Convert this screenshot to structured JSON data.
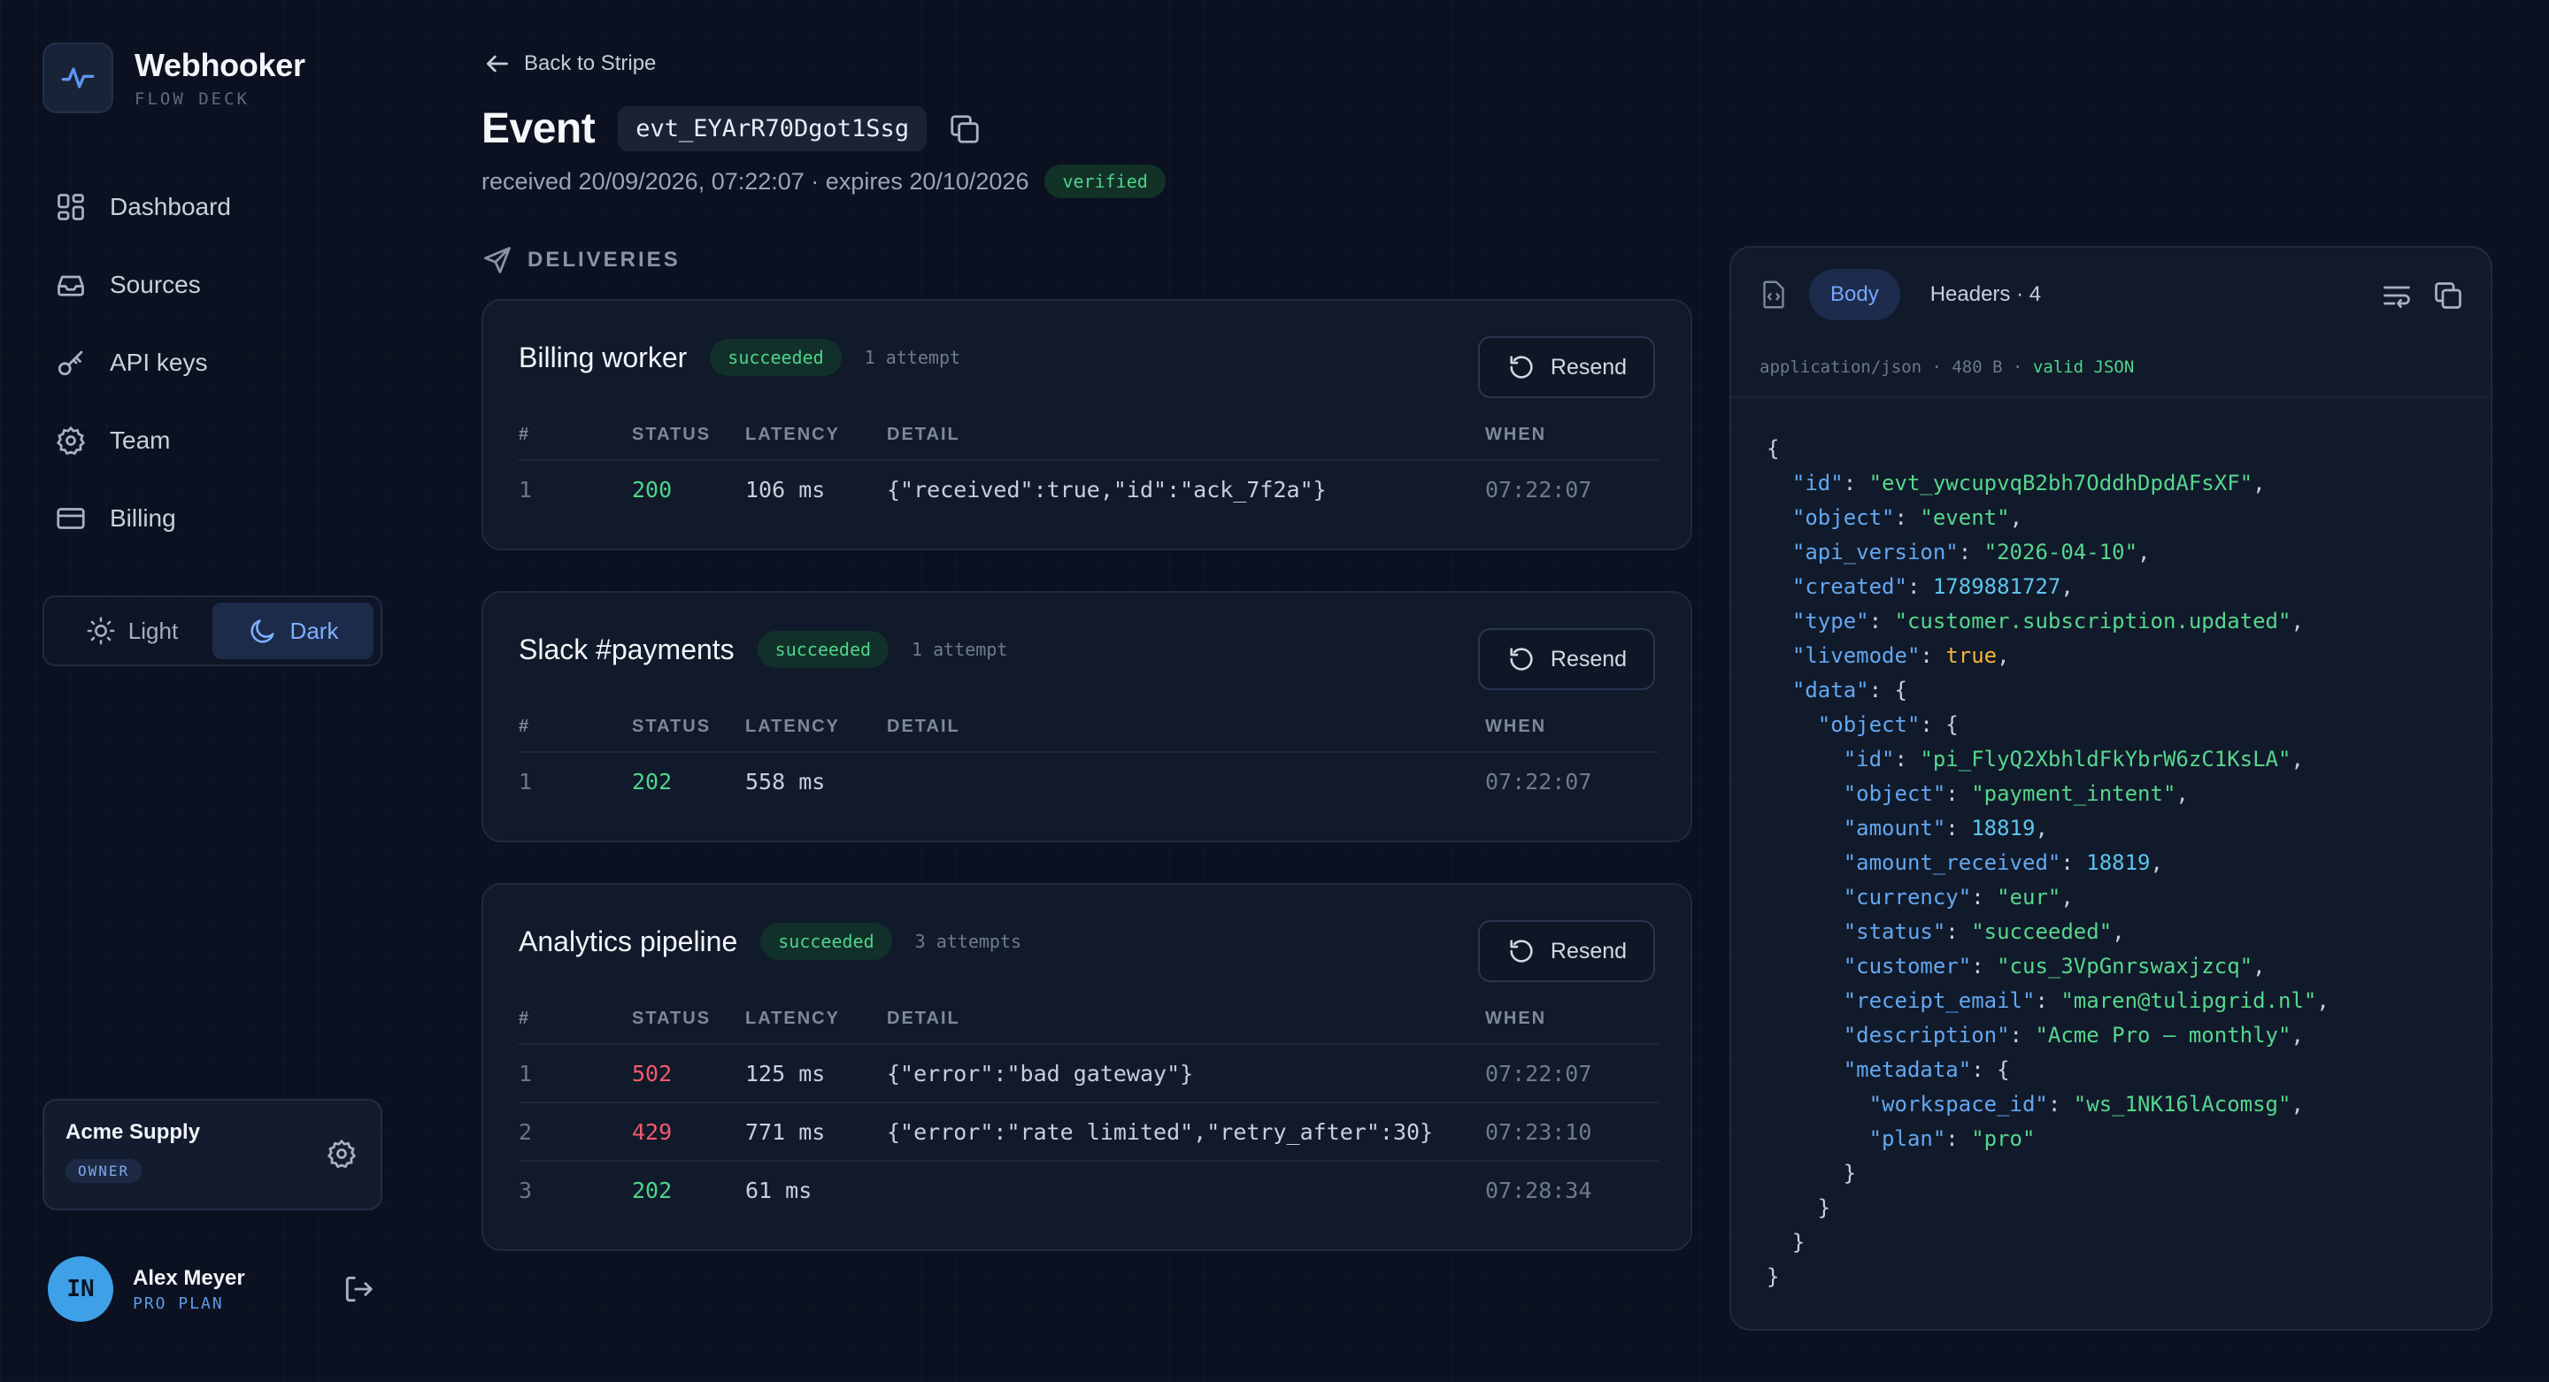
{
  "brand": {
    "name": "Webhooker",
    "sub": "FLOW DECK"
  },
  "nav": [
    {
      "label": "Dashboard",
      "icon": "dashboard-icon"
    },
    {
      "label": "Sources",
      "icon": "inbox-icon"
    },
    {
      "label": "API keys",
      "icon": "key-icon"
    },
    {
      "label": "Team",
      "icon": "gear-icon"
    },
    {
      "label": "Billing",
      "icon": "credit-card-icon"
    }
  ],
  "theme": {
    "light": "Light",
    "dark": "Dark",
    "selected": "Dark"
  },
  "org": {
    "name": "Acme Supply",
    "role": "OWNER"
  },
  "user": {
    "initials": "IN",
    "name": "Alex Meyer",
    "plan": "PRO PLAN"
  },
  "back_label": "Back to Stripe",
  "event": {
    "title": "Event",
    "id": "evt_EYArR70Dgot1Ssg",
    "meta": "received 20/09/2026, 07:22:07 · expires 20/10/2026",
    "badge": "verified"
  },
  "deliveries_heading": "DELIVERIES",
  "table_headers": {
    "num": "#",
    "status": "STATUS",
    "latency": "LATENCY",
    "detail": "DETAIL",
    "when": "WHEN"
  },
  "resend_label": "Resend",
  "deliveries": [
    {
      "name": "Billing worker",
      "status": "succeeded",
      "attempts": "1 attempt",
      "rows": [
        {
          "num": "1",
          "status": "200",
          "latency": "106 ms",
          "detail": "{\"received\":true,\"id\":\"ack_7f2a\"}",
          "when": "07:22:07",
          "ok": true
        }
      ]
    },
    {
      "name": "Slack #payments",
      "status": "succeeded",
      "attempts": "1 attempt",
      "rows": [
        {
          "num": "1",
          "status": "202",
          "latency": "558 ms",
          "detail": "",
          "when": "07:22:07",
          "ok": true
        }
      ]
    },
    {
      "name": "Analytics pipeline",
      "status": "succeeded",
      "attempts": "3 attempts",
      "rows": [
        {
          "num": "1",
          "status": "502",
          "latency": "125 ms",
          "detail": "{\"error\":\"bad gateway\"}",
          "when": "07:22:07",
          "ok": false
        },
        {
          "num": "2",
          "status": "429",
          "latency": "771 ms",
          "detail": "{\"error\":\"rate limited\",\"retry_after\":30}",
          "when": "07:23:10",
          "ok": false
        },
        {
          "num": "3",
          "status": "202",
          "latency": "61 ms",
          "detail": "",
          "when": "07:28:34",
          "ok": true
        }
      ]
    }
  ],
  "panel": {
    "tab_body": "Body",
    "tab_headers": "Headers · 4",
    "content_type": "application/json",
    "size": "480 B",
    "validity": "valid JSON",
    "separator": " · ",
    "json_lines": [
      [
        [
          "p",
          "{"
        ]
      ],
      [
        [
          "p",
          "  "
        ],
        [
          "k",
          "\"id\""
        ],
        [
          "p",
          ": "
        ],
        [
          "s",
          "\"evt_ywcupvqB2bh7OddhDpdAFsXF\""
        ],
        [
          "p",
          ","
        ]
      ],
      [
        [
          "p",
          "  "
        ],
        [
          "k",
          "\"object\""
        ],
        [
          "p",
          ": "
        ],
        [
          "s",
          "\"event\""
        ],
        [
          "p",
          ","
        ]
      ],
      [
        [
          "p",
          "  "
        ],
        [
          "k",
          "\"api_version\""
        ],
        [
          "p",
          ": "
        ],
        [
          "s",
          "\"2026-04-10\""
        ],
        [
          "p",
          ","
        ]
      ],
      [
        [
          "p",
          "  "
        ],
        [
          "k",
          "\"created\""
        ],
        [
          "p",
          ": "
        ],
        [
          "n",
          "1789881727"
        ],
        [
          "p",
          ","
        ]
      ],
      [
        [
          "p",
          "  "
        ],
        [
          "k",
          "\"type\""
        ],
        [
          "p",
          ": "
        ],
        [
          "s",
          "\"customer.subscription.updated\""
        ],
        [
          "p",
          ","
        ]
      ],
      [
        [
          "p",
          "  "
        ],
        [
          "k",
          "\"livemode\""
        ],
        [
          "p",
          ": "
        ],
        [
          "b",
          "true"
        ],
        [
          "p",
          ","
        ]
      ],
      [
        [
          "p",
          "  "
        ],
        [
          "k",
          "\"data\""
        ],
        [
          "p",
          ": {"
        ]
      ],
      [
        [
          "p",
          "    "
        ],
        [
          "k",
          "\"object\""
        ],
        [
          "p",
          ": {"
        ]
      ],
      [
        [
          "p",
          "      "
        ],
        [
          "k",
          "\"id\""
        ],
        [
          "p",
          ": "
        ],
        [
          "s",
          "\"pi_FlyQ2XbhldFkYbrW6zC1KsLA\""
        ],
        [
          "p",
          ","
        ]
      ],
      [
        [
          "p",
          "      "
        ],
        [
          "k",
          "\"object\""
        ],
        [
          "p",
          ": "
        ],
        [
          "s",
          "\"payment_intent\""
        ],
        [
          "p",
          ","
        ]
      ],
      [
        [
          "p",
          "      "
        ],
        [
          "k",
          "\"amount\""
        ],
        [
          "p",
          ": "
        ],
        [
          "n",
          "18819"
        ],
        [
          "p",
          ","
        ]
      ],
      [
        [
          "p",
          "      "
        ],
        [
          "k",
          "\"amount_received\""
        ],
        [
          "p",
          ": "
        ],
        [
          "n",
          "18819"
        ],
        [
          "p",
          ","
        ]
      ],
      [
        [
          "p",
          "      "
        ],
        [
          "k",
          "\"currency\""
        ],
        [
          "p",
          ": "
        ],
        [
          "s",
          "\"eur\""
        ],
        [
          "p",
          ","
        ]
      ],
      [
        [
          "p",
          "      "
        ],
        [
          "k",
          "\"status\""
        ],
        [
          "p",
          ": "
        ],
        [
          "s",
          "\"succeeded\""
        ],
        [
          "p",
          ","
        ]
      ],
      [
        [
          "p",
          "      "
        ],
        [
          "k",
          "\"customer\""
        ],
        [
          "p",
          ": "
        ],
        [
          "s",
          "\"cus_3VpGnrswaxjzcq\""
        ],
        [
          "p",
          ","
        ]
      ],
      [
        [
          "p",
          "      "
        ],
        [
          "k",
          "\"receipt_email\""
        ],
        [
          "p",
          ": "
        ],
        [
          "s",
          "\"maren@tulipgrid.nl\""
        ],
        [
          "p",
          ","
        ]
      ],
      [
        [
          "p",
          "      "
        ],
        [
          "k",
          "\"description\""
        ],
        [
          "p",
          ": "
        ],
        [
          "s",
          "\"Acme Pro — monthly\""
        ],
        [
          "p",
          ","
        ]
      ],
      [
        [
          "p",
          "      "
        ],
        [
          "k",
          "\"metadata\""
        ],
        [
          "p",
          ": {"
        ]
      ],
      [
        [
          "p",
          "        "
        ],
        [
          "k",
          "\"workspace_id\""
        ],
        [
          "p",
          ": "
        ],
        [
          "s",
          "\"ws_1NK16lAcomsg\""
        ],
        [
          "p",
          ","
        ]
      ],
      [
        [
          "p",
          "        "
        ],
        [
          "k",
          "\"plan\""
        ],
        [
          "p",
          ": "
        ],
        [
          "s",
          "\"pro\""
        ]
      ],
      [
        [
          "p",
          "      }"
        ]
      ],
      [
        [
          "p",
          "    }"
        ]
      ],
      [
        [
          "p",
          "  }"
        ]
      ],
      [
        [
          "p",
          "}"
        ]
      ]
    ]
  },
  "colors": {
    "accent": "#76a7ff",
    "success": "#4ed48a",
    "error": "#f25b6b",
    "background": "#0b1120"
  }
}
